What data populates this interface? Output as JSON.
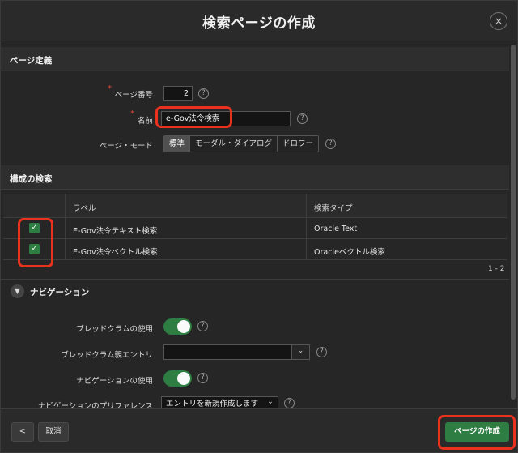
{
  "dialog": {
    "title": "検索ページの作成",
    "close_icon": "×"
  },
  "page_definition": {
    "section_title": "ページ定義",
    "page_number_label": "ページ番号",
    "page_number_value": "2",
    "name_label": "名前",
    "name_value": "e-Gov法令検索",
    "page_mode_label": "ページ・モード",
    "page_modes": [
      "標準",
      "モーダル・ダイアログ",
      "ドロワー"
    ],
    "page_mode_selected": "標準",
    "required_mark": "*",
    "help_glyph": "?"
  },
  "search_config": {
    "section_title": "構成の検索",
    "columns": [
      "ラベル",
      "検索タイプ"
    ],
    "rows": [
      {
        "checked": true,
        "label": "E-Gov法令テキスト検索",
        "type": "Oracle Text"
      },
      {
        "checked": true,
        "label": "E-Gov法令ベクトル検索",
        "type": "Oracleベクトル検索"
      }
    ],
    "pagination": "1 - 2",
    "check_glyph": "✓"
  },
  "navigation": {
    "section_title": "ナビゲーション",
    "collapse_glyph": "▼",
    "breadcrumb_use_label": "ブレッドクラムの使用",
    "breadcrumb_use_on": true,
    "breadcrumb_parent_label": "ブレッドクラム親エントリ",
    "breadcrumb_parent_value": "",
    "navigation_use_label": "ナビゲーションの使用",
    "navigation_use_on": true,
    "navigation_pref_label": "ナビゲーションのプリファレンス",
    "navigation_pref_value": "エントリを新規作成します",
    "chevron_glyph": "⌄"
  },
  "footer": {
    "back_glyph": "<",
    "cancel_label": "取消",
    "create_label": "ページの作成"
  },
  "colors": {
    "accent_green": "#2e7d43",
    "highlight_red": "#e8321e",
    "required_red": "#e04a3a"
  }
}
